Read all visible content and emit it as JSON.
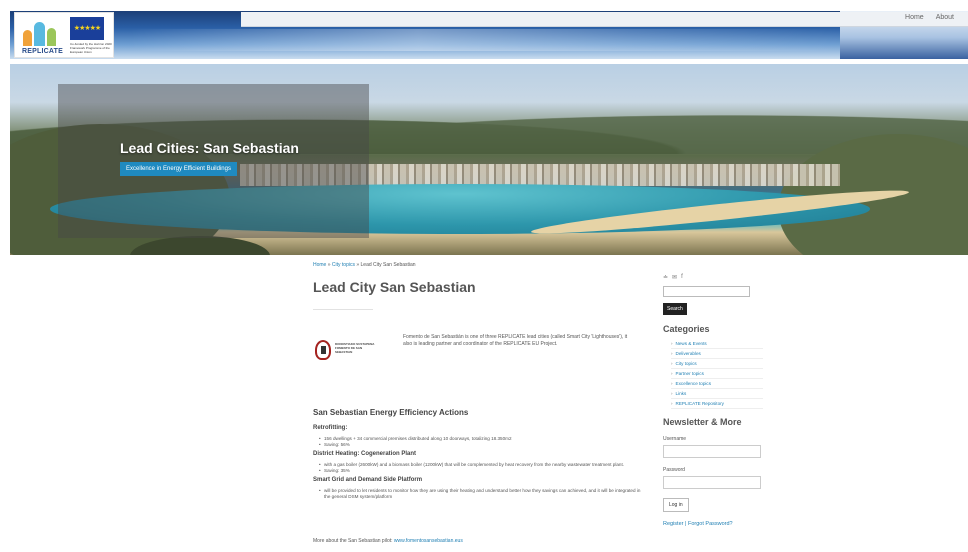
{
  "topnav": {
    "home": "Home",
    "about": "About"
  },
  "logo": {
    "name": "REPLICATE",
    "eu_text": "Co-funded by the Horizon 2020 Framework Programme of the European Union"
  },
  "hero": {
    "title": "Lead Cities: San Sebastian",
    "button_label": "Excellence in Energy Efficient Buildings"
  },
  "breadcrumb": {
    "home": "Home",
    "sep1": " » ",
    "topics": "City topics",
    "sep2": " » ",
    "current": "Lead City San Sebastian"
  },
  "page": {
    "title": "Lead City San Sebastian",
    "partner_logo_text": "DONOSTIAKO SUSTAPENA FOMENTO DE SAN SEBASTIAN",
    "intro": "Fomento de San Sebastián is one of three REPLICATE lead cities (called Smart City 'Lighthouses'), it also is leading partner and coordinator of the REPLICATE EU Project.",
    "section_title": "San Sebastian Energy Efficiency Actions",
    "blocks": [
      {
        "heading": "Retrofitting:",
        "items": [
          "156 dwellings + 34 commercial premises distributed along 10 doorways, totalizing 18.350m2",
          "Saving: 56%"
        ]
      },
      {
        "heading": "District Heating: Cogeneration Plant",
        "items": [
          "with a gas boiler (2600kW) and a biomass boiler (1200kW) that will be complemented by heat recovery from the nearby wastewater treatment plant.",
          "Saving: 35%"
        ]
      },
      {
        "heading": "Smart Grid and Demand Side Platform",
        "items": [
          "will be provided to let residents to monitor how they are using their heating and understand better how they savings can achieved, and it will be integrated in the general DSM system/platform"
        ]
      }
    ],
    "more_prefix": "More about the San Sebastian pilot: ",
    "more_link": "www.fomentosansebastian.eus"
  },
  "sidebar": {
    "social_icons": [
      "rss-icon",
      "mail-icon",
      "facebook-icon"
    ],
    "search_button": "Search",
    "categories_title": "Categories",
    "categories": [
      "News & Events",
      "Deliverables",
      "City topics",
      "Partner topics",
      "Excellence topics",
      "Links",
      "REPLICATE Repository"
    ],
    "newsletter_title": "Newsletter & More",
    "username_label": "Username",
    "password_label": "Password",
    "login_button": "Log in",
    "register": "Register",
    "divider": " | ",
    "forgot": "Forgot Password?"
  }
}
